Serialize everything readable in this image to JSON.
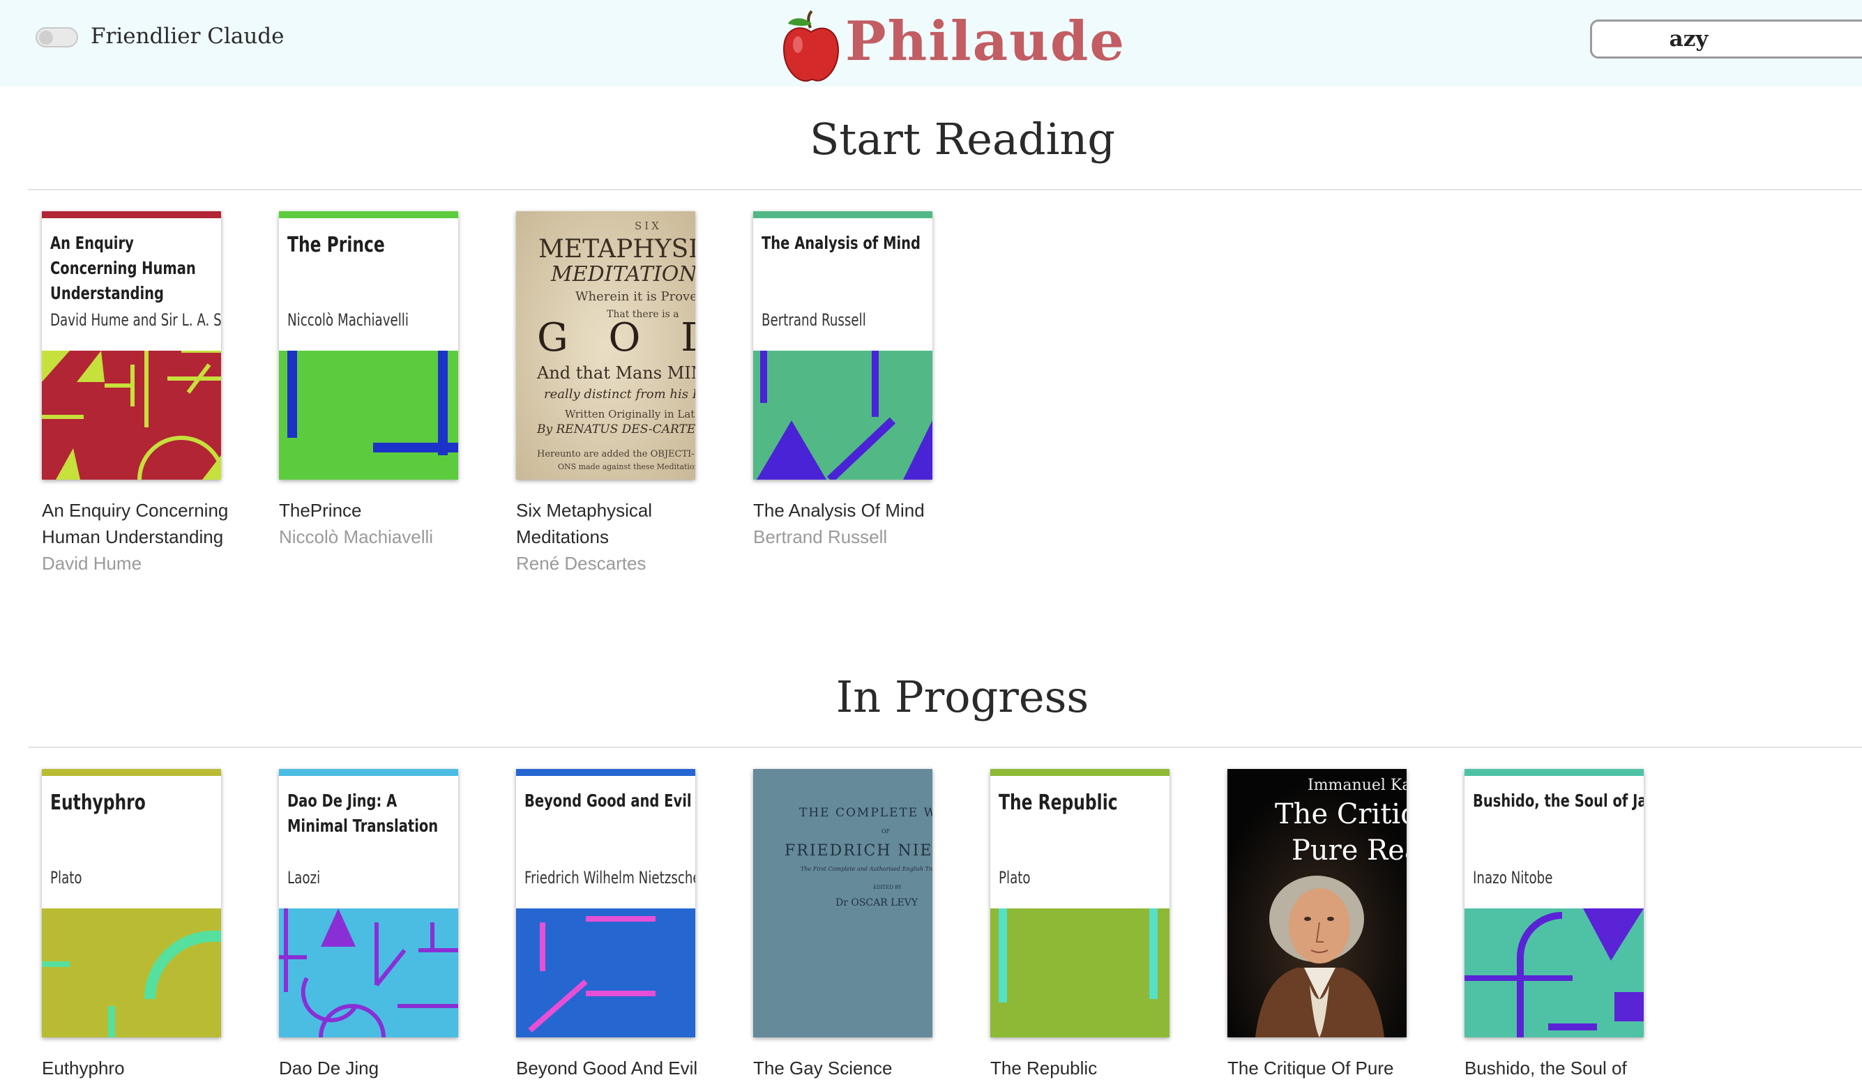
{
  "header": {
    "toggle_label": "Friendlier Claude",
    "logo_text": "Philaude",
    "search_value": "azy"
  },
  "sections": [
    {
      "title": "Start Reading",
      "books": [
        {
          "title": "An Enquiry Concerning Human Understanding",
          "author": "David Hume",
          "cover_title": "An Enquiry Concerning Human Understanding",
          "cover_author": "David Hume and Sir L. A. Selby-Bigge"
        },
        {
          "title": "ThePrince",
          "author": "Niccolò Machiavelli",
          "cover_title": "The Prince",
          "cover_author": "Niccolò Machiavelli"
        },
        {
          "title": "Six Metaphysical Meditations",
          "author": "René Descartes",
          "cover_lines": [
            "SIX",
            "METAPHYSICAL",
            "MEDITATIONS",
            "Wherein it is Proved",
            "That there is a",
            "G O D",
            "And that Mans MIND",
            "really distinct from his Body",
            "Written Originally in Latin",
            "By RENATUS DES-CARTES",
            "Hereunto are added the OBJECTI-",
            "ONS made against these Meditations"
          ]
        },
        {
          "title": "The Analysis Of Mind",
          "author": "Bertrand Russell",
          "cover_title": "The Analysis of Mind",
          "cover_author": "Bertrand Russell"
        }
      ]
    },
    {
      "title": "In Progress",
      "books": [
        {
          "title": "Euthyphro",
          "cover_title": "Euthyphro",
          "cover_author": "Plato"
        },
        {
          "title": "Dao De Jing",
          "cover_title": "Dao De Jing: A Minimal Translation",
          "cover_author": "Laozi"
        },
        {
          "title": "Beyond Good And Evil",
          "cover_title": "Beyond Good and Evil",
          "cover_author": "Friedrich Wilhelm Nietzsche"
        },
        {
          "title": "The Gay Science",
          "cover_lines": [
            "THE COMPLETE WORKS",
            "OF",
            "FRIEDRICH NIETZSCHE",
            "The First Complete and Authorised English Translation",
            "EDITED BY",
            "Dr OSCAR LEVY"
          ]
        },
        {
          "title": "The Republic",
          "cover_title": "The Republic",
          "cover_author": "Plato"
        },
        {
          "title": "The Critique Of Pure",
          "cover_lines": [
            "Immanuel Kant",
            "The Critique of",
            "Pure Reason"
          ]
        },
        {
          "title": "Bushido, the Soul of",
          "cover_title": "Bushido, the Soul of Japan",
          "cover_author": "Inazo Nitobe"
        }
      ]
    }
  ],
  "colors": {
    "header_bg": "#f0fbfd",
    "logo": "#c25d63",
    "enquiry": "#b22535",
    "enquiry_accent": "#c6e03c",
    "prince": "#5ccc3e",
    "prince_accent": "#1d32c8",
    "analysis": "#52b986",
    "analysis_accent": "#4a23d6",
    "euthyphro": "#b9bc32",
    "euthyphro_accent": "#55e0a0",
    "dao": "#4bbde2",
    "dao_accent": "#8a2fd6",
    "beyond": "#2566d1",
    "beyond_accent": "#e64fd6",
    "gay_science": "#658a9a",
    "republic": "#8eb936",
    "republic_accent": "#55e0c8",
    "bushido": "#4fc2a6",
    "bushido_accent": "#5a23d6"
  }
}
